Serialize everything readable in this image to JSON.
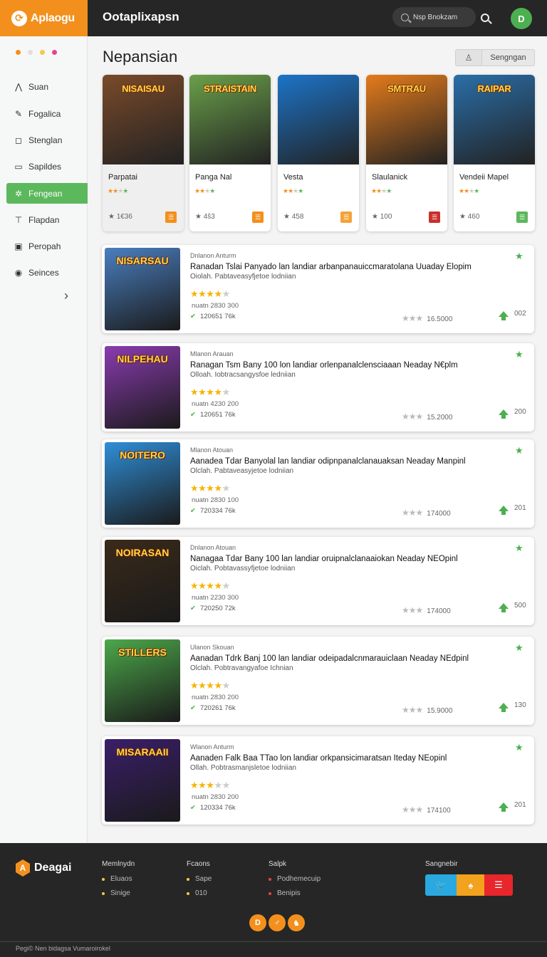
{
  "header": {
    "brand": "Aplaogu",
    "title": "Ootaplixapsn",
    "search_placeholder": "Nsp Bnokzam",
    "avatar_letter": "D"
  },
  "sidebar": {
    "dot_colors": [
      "#f3901d",
      "#e0e0e0",
      "#f2c94c",
      "#e84393"
    ],
    "items": [
      {
        "label": "Suan",
        "icon": "mountain-icon"
      },
      {
        "label": "Fogalica",
        "icon": "pen-icon"
      },
      {
        "label": "Stenglan",
        "icon": "square-icon"
      },
      {
        "label": "Sapildes",
        "icon": "document-icon"
      },
      {
        "label": "Fengean",
        "icon": "gamepad-icon",
        "active": true
      },
      {
        "label": "Flapdan",
        "icon": "shirt-icon"
      },
      {
        "label": "Peropah",
        "icon": "box-icon"
      },
      {
        "label": "Seinces",
        "icon": "circle-icon"
      }
    ]
  },
  "main": {
    "page_title": "Nepansian",
    "segment_label": "Sengngan",
    "featured": [
      {
        "art": "NISAISAU",
        "name": "Parpatai",
        "count": "1€36",
        "badge_color": "#f3901d",
        "bg": "#7a4a2a"
      },
      {
        "art": "STRAISTAIN",
        "name": "Panga Nal",
        "count": "4ŝ3",
        "badge_color": "#f3901d",
        "bg": "#6aa04a"
      },
      {
        "art": "",
        "name": "Vesta",
        "count": "458",
        "badge_color": "#f3a33a",
        "bg": "#1c74c8"
      },
      {
        "art": "SMTRAU",
        "name": "Slaulanick",
        "count": "100",
        "badge_color": "#c9302c",
        "bg": "#e47b1c"
      },
      {
        "art": "RAIPAR",
        "name": "Vendeii Mapel",
        "count": "460",
        "badge_color": "#5cb85c",
        "bg": "#2a6ea8"
      }
    ],
    "list": [
      {
        "art": "NISARSAU",
        "bg": "#4a7fc0",
        "kicker": "Dnlanon Anturm",
        "title": "Ranadan Tslai Panyado lan landiar arbanpanauiccmaratolana Uuaday Elopim",
        "sub": "Oiolah. Pabtaveasyfjetoe lodniian",
        "stars": 4,
        "meta1": "nuatn 2830 300",
        "meta2": "120651 76k",
        "rating": "16.5000",
        "up": "002"
      },
      {
        "art": "NILPEHAU",
        "bg": "#8a3bb0",
        "kicker": "Mlanon Arauan",
        "title": "Ranagan Tsm Bany 100 lon landiar orlenpanalclensciaaan Neaday N€plm",
        "sub": "Olloah. Iobtracsangysfoe ledniian",
        "stars": 4,
        "meta1": "nuatn 4230 200",
        "meta2": "120651 76k",
        "rating": "15.2000",
        "up": "200"
      },
      {
        "art": "NOITERO",
        "bg": "#2f8fd8",
        "kicker": "Mlanon Atouan",
        "title": "Aanadea Tdar Banyolal lan landiar odipnpanalclanauaksan Neaday Manpinl",
        "sub": "Olclah. Pabtaveasyjetoe lodniian",
        "stars": 4,
        "meta1": "nuatn 2830 100",
        "meta2": "720334 76k",
        "rating": "174000",
        "up": "201"
      },
      {
        "art": "NOIRASAN",
        "bg": "#3a2a1a",
        "kicker": "Dnlanon Atouan",
        "title": "Nanagaa Tdar Bany 100 lan landiar oruipnalclanaaiokan Neaday NEOpinl",
        "sub": "Oiclah. Pobtavassyfjetoe lodniian",
        "stars": 4,
        "meta1": "nuatn 2230 300",
        "meta2": "720250 72k",
        "rating": "174000",
        "up": "500"
      },
      {
        "art": "STILLERS",
        "bg": "#4ca84a",
        "kicker": "Ulanon Skouan",
        "title": "Aanadan Tdrk Banj 100 lan landiar odeipadalcnmarauiclaan Neaday NEdpinl",
        "sub": "Olclah. Pobtravangyafoe Ichnian",
        "stars": 4,
        "meta1": "nuatn 2830 200",
        "meta2": "720261 76k",
        "rating": "15.9000",
        "up": "130"
      },
      {
        "art": "MISARAAII",
        "bg": "#3a1e6a",
        "kicker": "Wlanon Anturm",
        "title": "Aanaden Falk Baa TTao lon landiar orkpansicimaratsan Iteday NEopinl",
        "sub": "Ollah. Pobtrasmanjsletoe lodniian",
        "stars": 3,
        "meta1": "nuatn 2830 200",
        "meta2": "120334 76k",
        "rating": "174100",
        "up": "201"
      }
    ]
  },
  "footer": {
    "brand": "Deagai",
    "columns": [
      {
        "title": "Memlnydn",
        "links": [
          "Eluaos",
          "Sinige"
        ],
        "bullet": "#f2c94c"
      },
      {
        "title": "Fcaons",
        "links": [
          "Sape",
          "010"
        ],
        "bullet": "#f2c94c"
      },
      {
        "title": "Salpk",
        "links": [
          "Podhemecuip",
          "Benipis"
        ],
        "bullet": "#e84343"
      }
    ],
    "social_title": "Sangnebir",
    "social": [
      {
        "icon": "twitter-icon",
        "glyph": "🐦",
        "color": "#29a9e0"
      },
      {
        "icon": "bell-icon",
        "glyph": "♠",
        "color": "#f3a21d"
      },
      {
        "icon": "menu-icon",
        "glyph": "☰",
        "color": "#e8262b"
      }
    ],
    "round_buttons": [
      "D",
      "♂",
      "♞"
    ],
    "copyright": "Pegi© Nen bidagsa Vumaroirokel"
  }
}
